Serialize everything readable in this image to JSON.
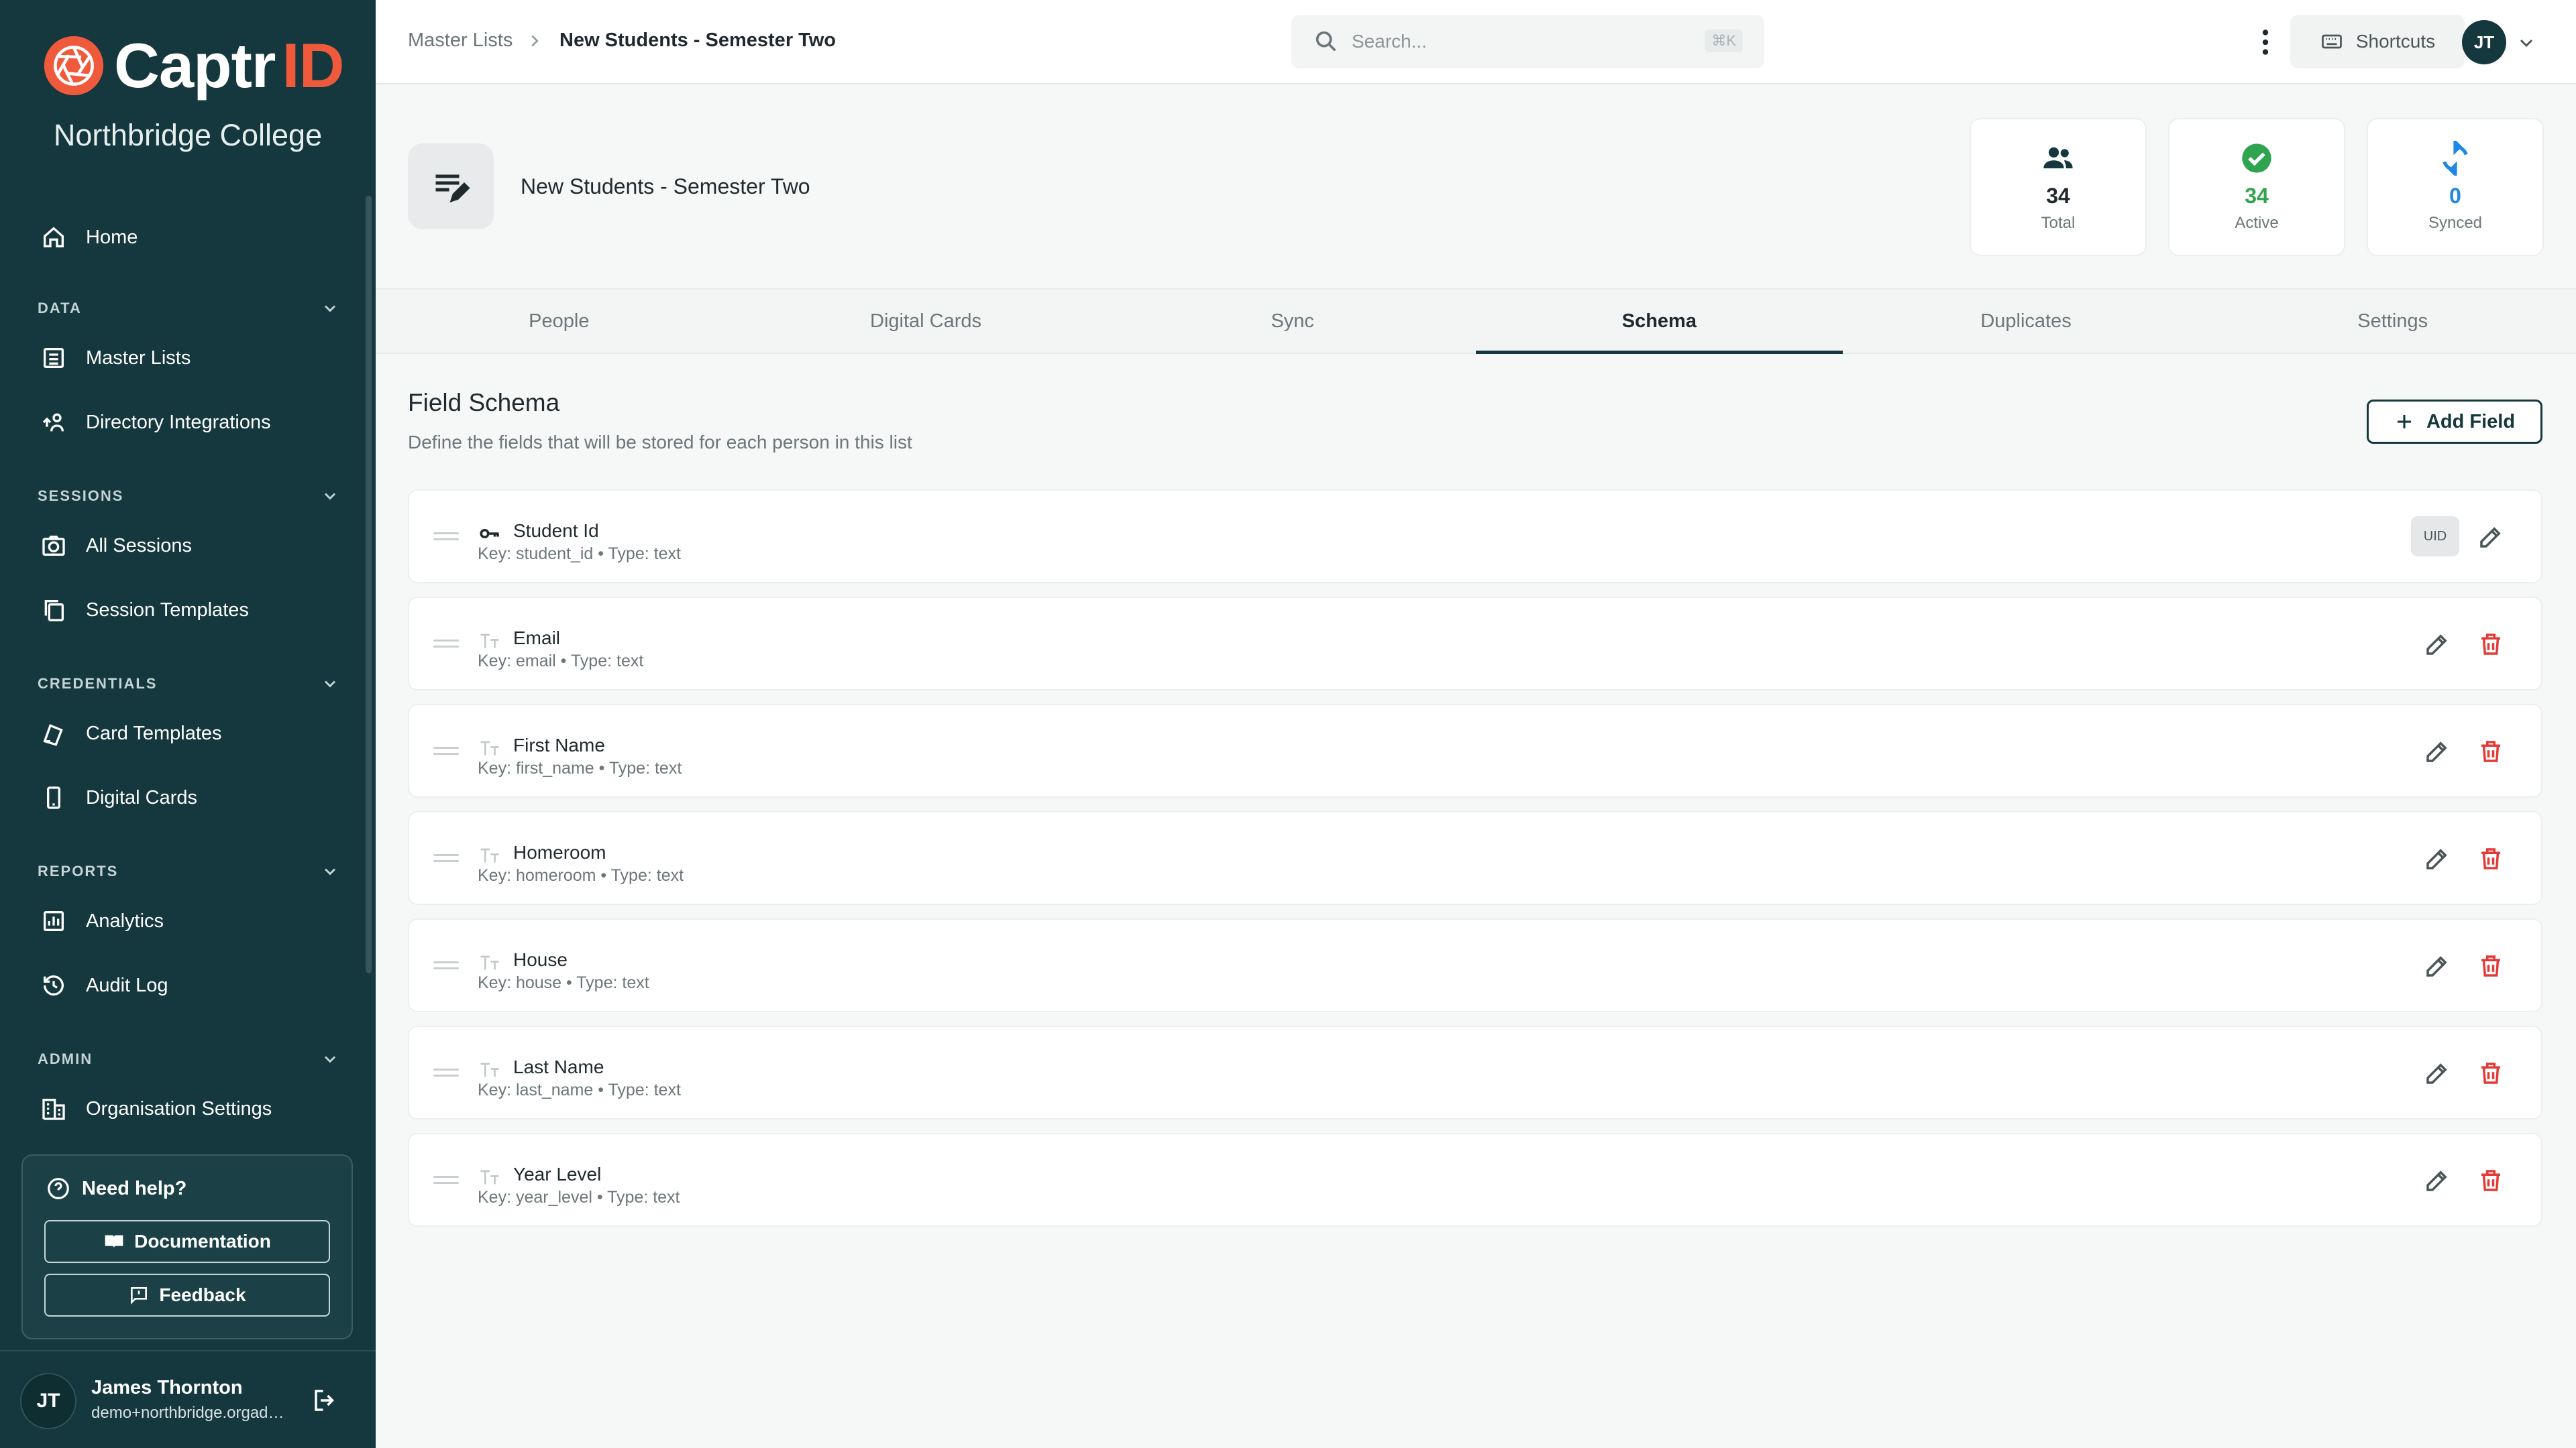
{
  "brand": {
    "name_part1": "Captr",
    "name_part2": "ID",
    "org": "Northbridge College"
  },
  "sidebar": {
    "home": "Home",
    "sections": [
      {
        "title": "DATA",
        "items": [
          "Master Lists",
          "Directory Integrations"
        ]
      },
      {
        "title": "SESSIONS",
        "items": [
          "All Sessions",
          "Session Templates"
        ]
      },
      {
        "title": "CREDENTIALS",
        "items": [
          "Card Templates",
          "Digital Cards"
        ]
      },
      {
        "title": "REPORTS",
        "items": [
          "Analytics",
          "Audit Log"
        ]
      },
      {
        "title": "ADMIN",
        "items": [
          "Organisation Settings"
        ]
      }
    ],
    "help": {
      "title": "Need help?",
      "documentation": "Documentation",
      "feedback": "Feedback"
    },
    "user": {
      "initials": "JT",
      "name": "James Thornton",
      "email": "demo+northbridge.orgadmin@captrid.com"
    }
  },
  "topbar": {
    "breadcrumb": [
      "Master Lists",
      "New Students - Semester Two"
    ],
    "search_placeholder": "Search...",
    "search_shortcut": "⌘K",
    "shortcuts": "Shortcuts",
    "avatar": "JT"
  },
  "header": {
    "title": "New Students - Semester Two",
    "stats": [
      {
        "value": "34",
        "label": "Total",
        "color": "#14383d",
        "icon": "people-icon"
      },
      {
        "value": "34",
        "label": "Active",
        "color": "#2ea44f",
        "icon": "check-circle-icon"
      },
      {
        "value": "0",
        "label": "Synced",
        "color": "#1e88e5",
        "icon": "sync-icon"
      }
    ]
  },
  "tabs": [
    "People",
    "Digital Cards",
    "Sync",
    "Schema",
    "Duplicates",
    "Settings"
  ],
  "active_tab": "Schema",
  "schema": {
    "title": "Field Schema",
    "description": "Define the fields that will be stored for each person in this list",
    "add_button": "Add Field",
    "uid_badge": "UID",
    "fields": [
      {
        "name": "Student Id",
        "meta": "Key: student_id • Type: text"
      },
      {
        "name": "Email",
        "meta": "Key: email • Type: text"
      },
      {
        "name": "First Name",
        "meta": "Key: first_name • Type: text"
      },
      {
        "name": "Homeroom",
        "meta": "Key: homeroom • Type: text"
      },
      {
        "name": "House",
        "meta": "Key: house • Type: text"
      },
      {
        "name": "Last Name",
        "meta": "Key: last_name • Type: text"
      },
      {
        "name": "Year Level",
        "meta": "Key: year_level • Type: text"
      }
    ]
  },
  "colors": {
    "sidebar": "#14383d",
    "accent": "#f05a3c",
    "danger": "#e53935",
    "success": "#2ea44f",
    "info": "#1e88e5"
  }
}
